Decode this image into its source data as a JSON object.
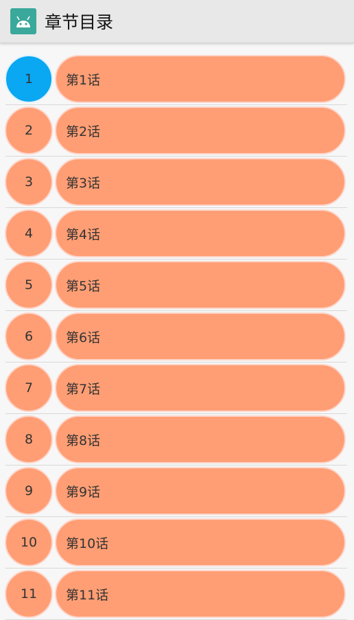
{
  "app_bar": {
    "title": "章节目录",
    "icon": "android-icon",
    "accent": "#3aa89a"
  },
  "colors": {
    "item_bg": "#ff9e74",
    "item_border": "#fcd6cc",
    "active_bg": "#0aa7f2"
  },
  "chapters": [
    {
      "num": "1",
      "title": "第1话",
      "active": true
    },
    {
      "num": "2",
      "title": "第2话"
    },
    {
      "num": "3",
      "title": "第3话"
    },
    {
      "num": "4",
      "title": "第4话"
    },
    {
      "num": "5",
      "title": "第5话"
    },
    {
      "num": "6",
      "title": "第6话"
    },
    {
      "num": "7",
      "title": "第7话"
    },
    {
      "num": "8",
      "title": "第8话"
    },
    {
      "num": "9",
      "title": "第9话"
    },
    {
      "num": "10",
      "title": "第10话"
    },
    {
      "num": "11",
      "title": "第11话"
    }
  ]
}
